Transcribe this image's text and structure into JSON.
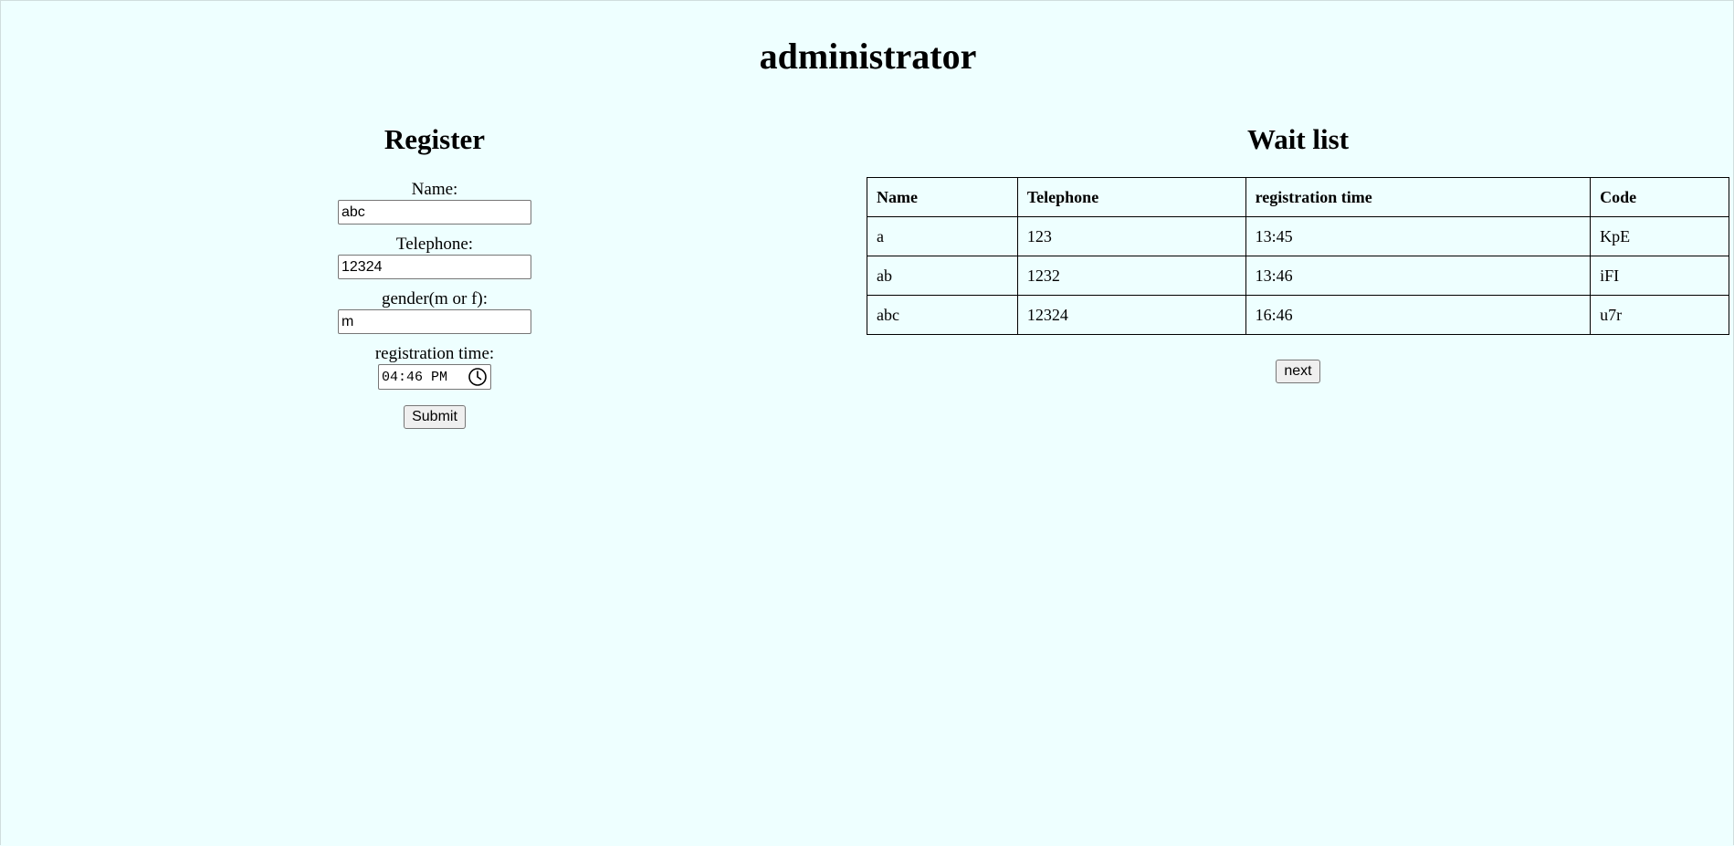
{
  "page": {
    "title": "administrator",
    "background": "#eeffff"
  },
  "register": {
    "title": "Register",
    "fields": [
      {
        "label": "Name:",
        "value": "abc"
      },
      {
        "label": "Telephone:",
        "value": "12324"
      },
      {
        "label": "gender(m or f):",
        "value": "m"
      }
    ],
    "time": {
      "label": "registration time:",
      "value": "04:46 PM",
      "icon": "clock-icon"
    },
    "submit_label": "Submit"
  },
  "waitlist": {
    "title": "Wait list",
    "columns": [
      "Name",
      "Telephone",
      "registration time",
      "Code"
    ],
    "rows": [
      [
        "a",
        "123",
        "13:45",
        "KpE"
      ],
      [
        "ab",
        "1232",
        "13:46",
        "iFI"
      ],
      [
        "abc",
        "12324",
        "16:46",
        "u7r"
      ]
    ],
    "next_label": "next"
  }
}
